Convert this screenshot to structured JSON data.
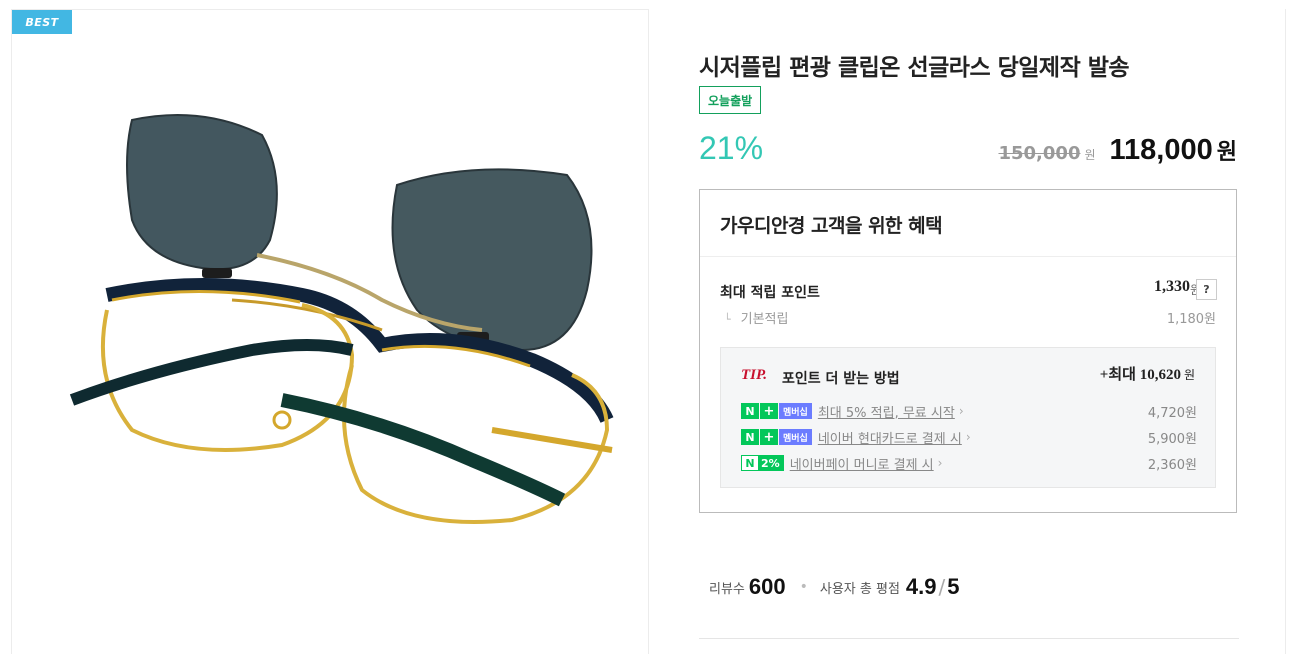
{
  "badges": {
    "best": "BEST",
    "shipping": "오늘출발"
  },
  "product": {
    "title": "시저플립 편광 클립온 선글라스 당일제작 발송",
    "discount": "21%",
    "original_price": "150,000",
    "original_price_unit": "원",
    "sale_price": "118,000",
    "sale_price_unit": "원"
  },
  "benefits": {
    "title": "가우디안경 고객을 위한 혜택",
    "max_point_label": "최대 적립 포인트",
    "max_point_value": "1,330",
    "max_point_unit": "원",
    "help_label": "?",
    "basic_label": "기본적립",
    "basic_value": "1,180원",
    "tip": {
      "tag": "TIP.",
      "text": "포인트 더 받는 방법",
      "max_text": "+최대 10,620",
      "max_unit": "원",
      "rows": [
        {
          "badge_n": "N",
          "badge_plus": "+",
          "badge_member": "멤버십",
          "label": "최대 5% 적립, 무료 시작",
          "amount": "4,720원"
        },
        {
          "badge_n": "N",
          "badge_plus": "+",
          "badge_member": "멤버십",
          "label": "네이버 현대카드로 결제 시",
          "amount": "5,900원"
        },
        {
          "badge_n": "N",
          "badge_pct": "2%",
          "label": "네이버페이 머니로 결제 시",
          "amount": "2,360원"
        }
      ]
    }
  },
  "review": {
    "count_label": "리뷰수",
    "count": "600",
    "rating_label": "사용자 총 평점",
    "rating": "4.9",
    "rating_max": "5"
  },
  "colors": {
    "accent_teal": "#33c7b4",
    "naver_green": "#03c75a",
    "best_blue": "#42b7e3",
    "tip_red": "#c8102e"
  }
}
